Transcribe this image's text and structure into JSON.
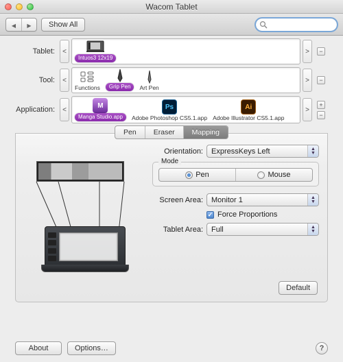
{
  "window_title": "Wacom Tablet",
  "toolbar": {
    "show_all_label": "Show All",
    "back_icon": "chevron-left-icon",
    "forward_icon": "chevron-right-icon",
    "search_placeholder": "",
    "search_value": ""
  },
  "rows": {
    "tablet": {
      "label": "Tablet:",
      "items": [
        {
          "name": "Intuos3 12x19",
          "selected": true
        }
      ]
    },
    "tool": {
      "label": "Tool:",
      "items": [
        {
          "name": "Functions",
          "selected": false
        },
        {
          "name": "Grip Pen",
          "selected": true
        },
        {
          "name": "Art Pen",
          "selected": false
        }
      ]
    },
    "application": {
      "label": "Application:",
      "items": [
        {
          "name": "Manga Studio.app",
          "selected": true,
          "icon": "ms"
        },
        {
          "name": "Adobe Photoshop CS5.1.app",
          "selected": false,
          "icon": "ps"
        },
        {
          "name": "Adobe Illustrator CS5.1.app",
          "selected": false,
          "icon": "ai"
        }
      ]
    }
  },
  "tabs": {
    "items": [
      "Pen",
      "Eraser",
      "Mapping"
    ],
    "active": "Mapping"
  },
  "mapping": {
    "orientation": {
      "label": "Orientation:",
      "value": "ExpressKeys Left"
    },
    "mode": {
      "label": "Mode",
      "selected": "Pen",
      "option_pen": "Pen",
      "option_mouse": "Mouse"
    },
    "screen_area": {
      "label": "Screen Area:",
      "value": "Monitor 1"
    },
    "force_proportions": {
      "label": "Force Proportions",
      "checked": true
    },
    "tablet_area": {
      "label": "Tablet Area:",
      "value": "Full"
    },
    "default_label": "Default"
  },
  "footer": {
    "about_label": "About",
    "options_label": "Options…"
  },
  "glyphs": {
    "plus": "+",
    "minus": "−",
    "lt": "<",
    "gt": ">",
    "help": "?"
  }
}
